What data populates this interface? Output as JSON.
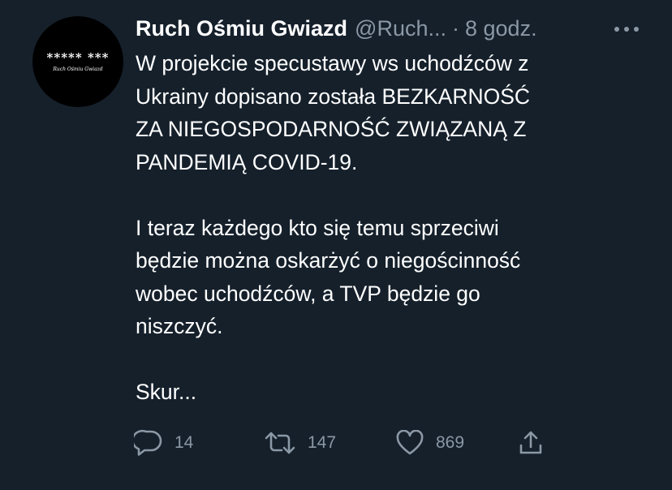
{
  "tweet": {
    "author": {
      "display_name": "Ruch Ośmiu Gwiazd",
      "handle": "@Ruch...",
      "avatar_logo_text": "***** ***",
      "avatar_sub_text": "Ruch Ośmiu Gwiazd"
    },
    "separator": "·",
    "timestamp": "8 godz.",
    "more_icon": "more-horizontal-icon",
    "text_lines": [
      "W projekcie specustawy ws uchodźców z",
      "Ukrainy dopisano została BEZKARNOŚĆ",
      "ZA NIEGOSPODARNOŚĆ ZWIĄZANĄ Z",
      "PANDEMIĄ COVID-19.",
      "",
      "I teraz każdego kto się temu sprzeciwi",
      "będzie można oskarżyć o niegościnność",
      "wobec uchodźców, a TVP będzie go",
      "niszczyć.",
      "",
      "Skur..."
    ],
    "actions": {
      "reply": {
        "icon": "reply-icon",
        "count": "14"
      },
      "retweet": {
        "icon": "retweet-icon",
        "count": "147"
      },
      "like": {
        "icon": "heart-icon",
        "count": "869"
      },
      "share": {
        "icon": "share-icon"
      }
    }
  },
  "colors": {
    "background": "#15202b",
    "primary_text": "#ffffff",
    "secondary_text": "#8b98a5",
    "avatar_bg": "#000000"
  }
}
